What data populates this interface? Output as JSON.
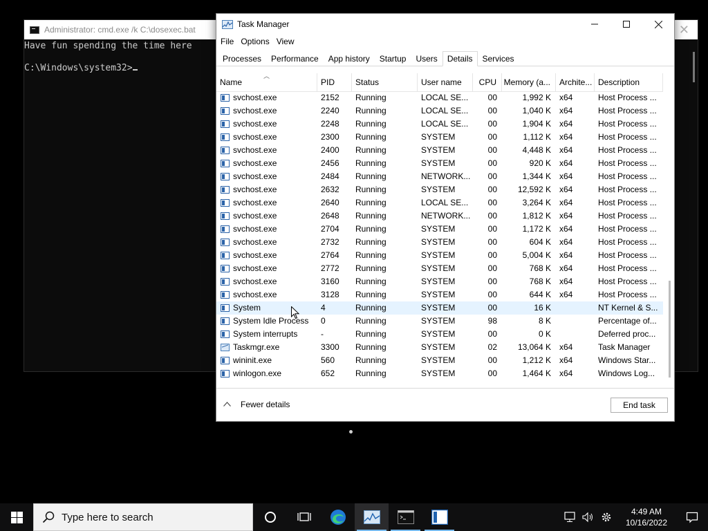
{
  "cmd": {
    "title": "Administrator: cmd.exe /k C:\\dosexec.bat",
    "lines": [
      "Have fun spending the time here",
      "",
      "C:\\Windows\\system32>"
    ]
  },
  "taskmanager": {
    "title": "Task Manager",
    "menu": [
      "File",
      "Options",
      "View"
    ],
    "tabs": [
      "Processes",
      "Performance",
      "App history",
      "Startup",
      "Users",
      "Details",
      "Services"
    ],
    "active_tab": "Details",
    "columns": [
      "Name",
      "PID",
      "Status",
      "User name",
      "CPU",
      "Memory (a...",
      "Archite...",
      "Description"
    ],
    "rows": [
      [
        "svchost.exe",
        "2152",
        "Running",
        "LOCAL SE...",
        "00",
        "1,992 K",
        "x64",
        "Host Process ..."
      ],
      [
        "svchost.exe",
        "2240",
        "Running",
        "LOCAL SE...",
        "00",
        "1,040 K",
        "x64",
        "Host Process ..."
      ],
      [
        "svchost.exe",
        "2248",
        "Running",
        "LOCAL SE...",
        "00",
        "1,904 K",
        "x64",
        "Host Process ..."
      ],
      [
        "svchost.exe",
        "2300",
        "Running",
        "SYSTEM",
        "00",
        "1,112 K",
        "x64",
        "Host Process ..."
      ],
      [
        "svchost.exe",
        "2400",
        "Running",
        "SYSTEM",
        "00",
        "4,448 K",
        "x64",
        "Host Process ..."
      ],
      [
        "svchost.exe",
        "2456",
        "Running",
        "SYSTEM",
        "00",
        "920 K",
        "x64",
        "Host Process ..."
      ],
      [
        "svchost.exe",
        "2484",
        "Running",
        "NETWORK...",
        "00",
        "1,344 K",
        "x64",
        "Host Process ..."
      ],
      [
        "svchost.exe",
        "2632",
        "Running",
        "SYSTEM",
        "00",
        "12,592 K",
        "x64",
        "Host Process ..."
      ],
      [
        "svchost.exe",
        "2640",
        "Running",
        "LOCAL SE...",
        "00",
        "3,264 K",
        "x64",
        "Host Process ..."
      ],
      [
        "svchost.exe",
        "2648",
        "Running",
        "NETWORK...",
        "00",
        "1,812 K",
        "x64",
        "Host Process ..."
      ],
      [
        "svchost.exe",
        "2704",
        "Running",
        "SYSTEM",
        "00",
        "1,172 K",
        "x64",
        "Host Process ..."
      ],
      [
        "svchost.exe",
        "2732",
        "Running",
        "SYSTEM",
        "00",
        "604 K",
        "x64",
        "Host Process ..."
      ],
      [
        "svchost.exe",
        "2764",
        "Running",
        "SYSTEM",
        "00",
        "5,004 K",
        "x64",
        "Host Process ..."
      ],
      [
        "svchost.exe",
        "2772",
        "Running",
        "SYSTEM",
        "00",
        "768 K",
        "x64",
        "Host Process ..."
      ],
      [
        "svchost.exe",
        "3160",
        "Running",
        "SYSTEM",
        "00",
        "768 K",
        "x64",
        "Host Process ..."
      ],
      [
        "svchost.exe",
        "3128",
        "Running",
        "SYSTEM",
        "00",
        "644 K",
        "x64",
        "Host Process ..."
      ],
      [
        "System",
        "4",
        "Running",
        "SYSTEM",
        "00",
        "16 K",
        "",
        "NT Kernel & S..."
      ],
      [
        "System Idle Process",
        "0",
        "Running",
        "SYSTEM",
        "98",
        "8 K",
        "",
        "Percentage of..."
      ],
      [
        "System interrupts",
        "-",
        "Running",
        "SYSTEM",
        "00",
        "0 K",
        "",
        "Deferred proc..."
      ],
      [
        "Taskmgr.exe",
        "3300",
        "Running",
        "SYSTEM",
        "02",
        "13,064 K",
        "x64",
        "Task Manager"
      ],
      [
        "wininit.exe",
        "560",
        "Running",
        "SYSTEM",
        "00",
        "1,212 K",
        "x64",
        "Windows Star..."
      ],
      [
        "winlogon.exe",
        "652",
        "Running",
        "SYSTEM",
        "00",
        "1,464 K",
        "x64",
        "Windows Log..."
      ]
    ],
    "hover_row": 16,
    "fewer_details": "Fewer details",
    "end_task": "End task"
  },
  "taskbar": {
    "search_placeholder": "Type here to search",
    "time": "4:49 AM",
    "date": "10/16/2022",
    "accent": "#76b9ed"
  }
}
